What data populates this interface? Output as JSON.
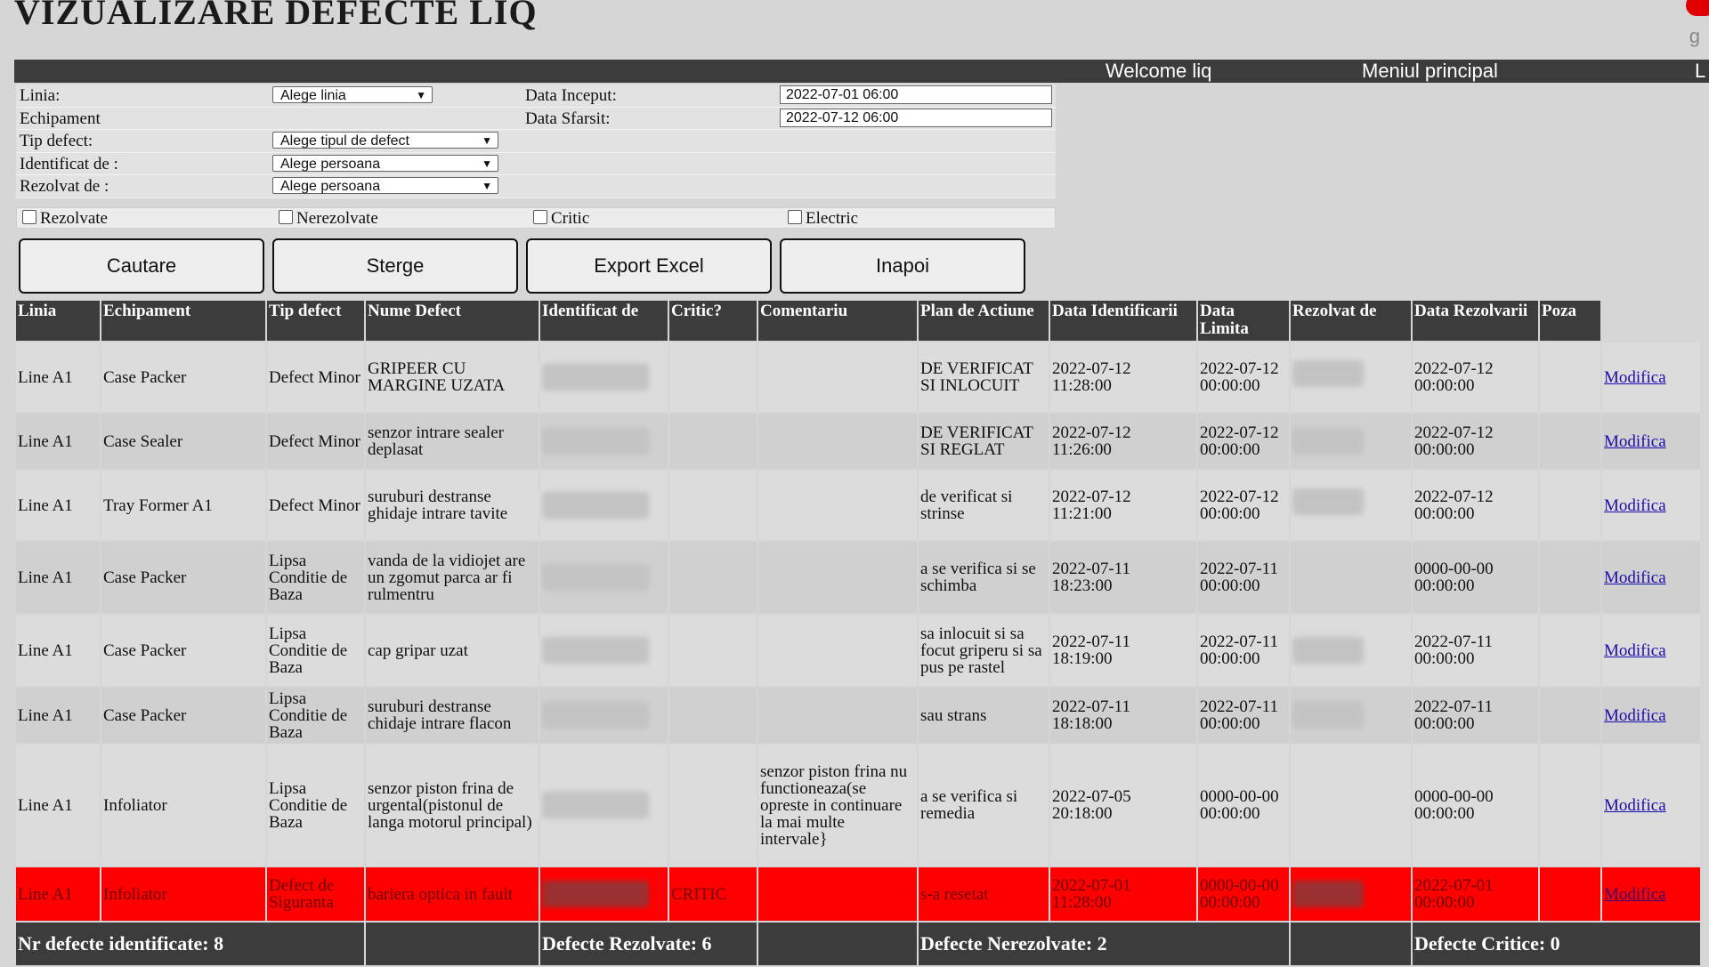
{
  "title": "VIZUALIZARE DEFECTE LIQ",
  "corner_letter": "g",
  "navbar": {
    "welcome": "Welcome liq",
    "menu": "Meniul principal",
    "extra": "L"
  },
  "filters": {
    "linia_label": "Linia:",
    "linia_value": "Alege linia",
    "data_inceput_label": "Data Inceput:",
    "data_inceput_value": "2022-07-01 06:00",
    "echipament_label": "Echipament",
    "data_sfarsit_label": "Data Sfarsit:",
    "data_sfarsit_value": "2022-07-12 06:00",
    "tip_defect_label": "Tip defect:",
    "tip_defect_value": "Alege tipul de defect",
    "identificat_label": "Identificat de :",
    "identificat_value": "Alege persoana",
    "rezolvat_label": "Rezolvat de :",
    "rezolvat_value": "Alege persoana"
  },
  "checkboxes": {
    "rezolvate": "Rezolvate",
    "nerezolvate": "Nerezolvate",
    "critic": "Critic",
    "electric": "Electric"
  },
  "buttons": {
    "search": "Cautare",
    "clear": "Sterge",
    "export": "Export Excel",
    "back": "Inapoi"
  },
  "table": {
    "headers": [
      "Linia",
      "Echipament",
      "Tip defect",
      "Nume Defect",
      "Identificat de",
      "Critic?",
      "Comentariu",
      "Plan de Actiune",
      "Data Identificarii",
      "Data Limita",
      "Rezolvat de",
      "Data Rezolvarii",
      "Poza"
    ],
    "link_label": "Modifica",
    "rows": [
      {
        "linia": "Line A1",
        "echip": "Case Packer",
        "tip": "Defect Minor",
        "nume": "GRIPEER CU MARGINE UZATA",
        "ident": "T…re",
        "critic": "",
        "coment": "",
        "plan": "DE VERIFICAT SI INLOCUIT",
        "data_id": "2022-07-12 11:28:00",
        "limita": "2022-07-12 00:00:00",
        "rezolvat": "TE… Petre",
        "data_rez": "2022-07-12 00:00:00"
      },
      {
        "linia": "Line A1",
        "echip": "Case Sealer",
        "tip": "Defect Minor",
        "nume": "senzor intrare sealer deplasat",
        "ident": "TE…e",
        "critic": "",
        "coment": "",
        "plan": "DE VERIFICAT SI REGLAT",
        "data_id": "2022-07-12 11:26:00",
        "limita": "2022-07-12 00:00:00",
        "rezolvat": "T… P…",
        "data_rez": "2022-07-12 00:00:00"
      },
      {
        "linia": "Line A1",
        "echip": "Tray Former A1",
        "tip": "Defect Minor",
        "nume": "suruburi destranse ghidaje intrare tavite",
        "ident": "T…e",
        "critic": "",
        "coment": "",
        "plan": "de verificat si strinse",
        "data_id": "2022-07-12 11:21:00",
        "limita": "2022-07-12 00:00:00",
        "rezolvat": "TE… Petre",
        "data_rez": "2022-07-12 00:00:00"
      },
      {
        "linia": "Line A1",
        "echip": "Case Packer",
        "tip": "Lipsa Conditie de Baza",
        "nume": "vanda de la vidiojet are un zgomut parca ar fi rulmentru",
        "ident": "C… C…",
        "critic": "",
        "coment": "",
        "plan": "a se verifica si se schimba",
        "data_id": "2022-07-11 18:23:00",
        "limita": "2022-07-11 00:00:00",
        "rezolvat": "",
        "data_rez": "0000-00-00 00:00:00"
      },
      {
        "linia": "Line A1",
        "echip": "Case Packer",
        "tip": "Lipsa Conditie de Baza",
        "nume": "cap gripar uzat",
        "ident": "C… C…",
        "critic": "",
        "coment": "",
        "plan": "sa inlocuit si sa focut griperu si sa pus pe rastel",
        "data_id": "2022-07-11 18:19:00",
        "limita": "2022-07-11 00:00:00",
        "rezolvat": "C… C…",
        "data_rez": "2022-07-11 00:00:00"
      },
      {
        "linia": "Line A1",
        "echip": "Case Packer",
        "tip": "Lipsa Conditie de Baza",
        "nume": "suruburi destranse chidaje intrare flacon",
        "ident": "C… Costel",
        "critic": "",
        "coment": "",
        "plan": "sau strans",
        "data_id": "2022-07-11 18:18:00",
        "limita": "2022-07-11 00:00:00",
        "rezolvat": "C…a C…",
        "data_rez": "2022-07-11 00:00:00"
      },
      {
        "linia": "Line A1",
        "echip": "Infoliator",
        "tip": "Lipsa Conditie de Baza",
        "nume": "senzor piston frina de urgental(pistonul de langa motorul principal)",
        "ident": "P… …",
        "critic": "",
        "coment": "senzor piston frina nu functioneaza(se opreste in continuare la mai multe intervale}",
        "plan": "a se verifica si remedia",
        "data_id": "2022-07-05 20:18:00",
        "limita": "0000-00-00 00:00:00",
        "rezolvat": "",
        "data_rez": "0000-00-00 00:00:00"
      },
      {
        "linia": "Line A1",
        "echip": "Infoliator",
        "tip": "Defect de Siguranta",
        "nume": "bariera optica in fault",
        "ident": "…",
        "critic": "CRITIC",
        "coment": "",
        "plan": "s-a resetat",
        "data_id": "2022-07-01 11:28:00",
        "limita": "0000-00-00 00:00:00",
        "rezolvat": "P…",
        "data_rez": "2022-07-01 00:00:00",
        "critical": true
      }
    ],
    "footer": {
      "identificate": "Nr defecte identificate: 8",
      "rezolvate": "Defecte Rezolvate: 6",
      "nerezolvate": "Defecte Nerezolvate: 2",
      "critice": "Defecte Critice: 0"
    }
  }
}
